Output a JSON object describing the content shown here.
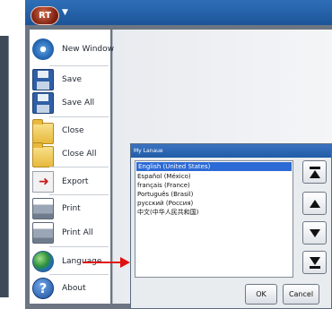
{
  "app": {
    "orb_label": "RT"
  },
  "menu": {
    "items": [
      {
        "label": "New Window",
        "icon": "gear-icon"
      },
      {
        "label": "Save",
        "icon": "floppy-disk-icon"
      },
      {
        "label": "Save All",
        "icon": "floppy-disk-icon"
      },
      {
        "label": "Close",
        "icon": "folder-icon"
      },
      {
        "label": "Close All",
        "icon": "folder-icon"
      },
      {
        "label": "Export",
        "icon": "export-icon"
      },
      {
        "label": "Print",
        "icon": "printer-icon"
      },
      {
        "label": "Print All",
        "icon": "printer-icon"
      },
      {
        "label": "Language",
        "icon": "globe-icon"
      },
      {
        "label": "About",
        "icon": "help-icon"
      }
    ]
  },
  "dialog": {
    "title": "My Lanaue",
    "languages": [
      "English (United States)",
      "Español (México)",
      "français (France)",
      "Português (Brasil)",
      "русский (Россия)",
      "中文(中华人民共和国)"
    ],
    "selected_index": 0,
    "ok_label": "OK",
    "cancel_label": "Cancel"
  },
  "colors": {
    "accent": "#2c6ad6",
    "arrow": "#e01010",
    "title_bar": "#2f6fb8"
  }
}
